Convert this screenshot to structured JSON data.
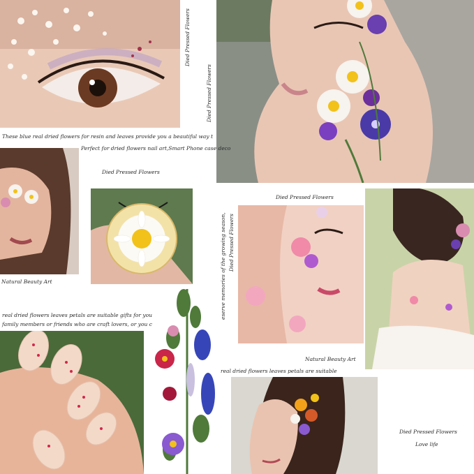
{
  "captions": {
    "vertical_top_1": "Died Pressed Flowers",
    "vertical_top_2": "Died Pressed Flowers",
    "blue_flowers_line": "These blue real dried flowers for resin and leaves provide you a beautiful way t",
    "nail_art_line": "Perfect for dried flowers nail art,Smart Phone case deco",
    "pendant_title": "Died Pressed Flowers",
    "natural_beauty_left": "Natural Beauty Art",
    "gifts_line_1": "real dried flowers leaves petals are suitable gifts for your",
    "gifts_line_2": "family members or friends who are craft lovers, or you can",
    "center_title": "Died Pressed Flowers",
    "vertical_mid_1": "eserve memories of the growing season,",
    "vertical_mid_2": "Died Pressed Flowers",
    "natural_beauty_mid": "Natural Beauty Art",
    "suitable_line": "real dried flowers leaves petals are suitable",
    "bottom_right_title": "Died Pressed Flowers",
    "love_life": "Love life"
  },
  "colors": {
    "background": "#ffffff",
    "skin": "#e8c2ae",
    "flower_purple": "#6a3fb0",
    "flower_yellow": "#f2c21a",
    "flower_pink": "#f08aa8",
    "leaf_green": "#4f7a3a"
  }
}
